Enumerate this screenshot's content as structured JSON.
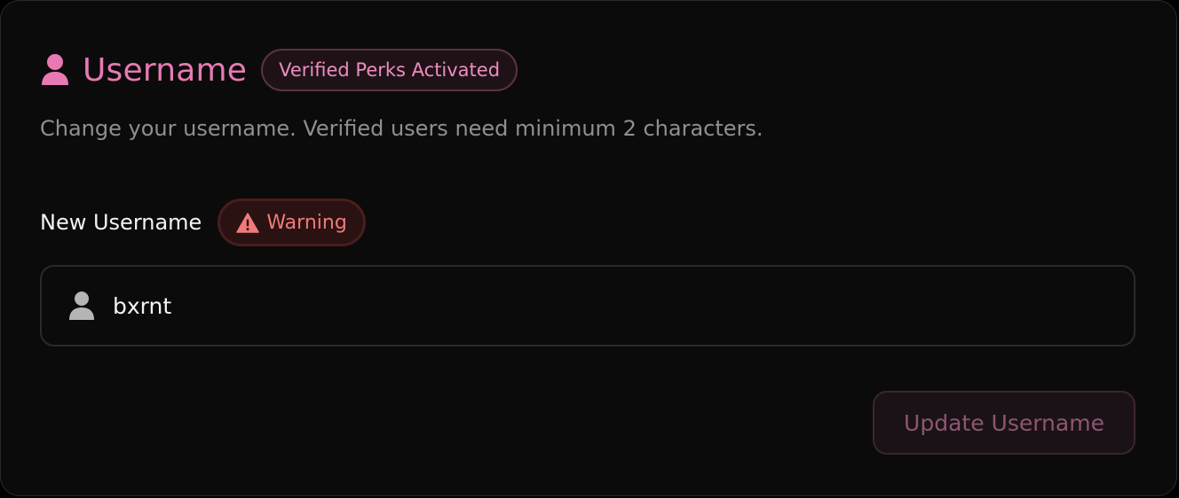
{
  "header": {
    "title": "Username",
    "icon": "user-icon",
    "badge": "Verified Perks Activated"
  },
  "description": "Change your username. Verified users need minimum 2 characters.",
  "field": {
    "label": "New Username",
    "warning_badge": "Warning",
    "warning_icon": "warning-triangle-icon",
    "input_icon": "user-icon",
    "value": "bxrnt"
  },
  "actions": {
    "update_label": "Update Username"
  },
  "colors": {
    "accent": "#e879b3",
    "warning": "#f07a7a",
    "background": "#0b0b0b"
  }
}
